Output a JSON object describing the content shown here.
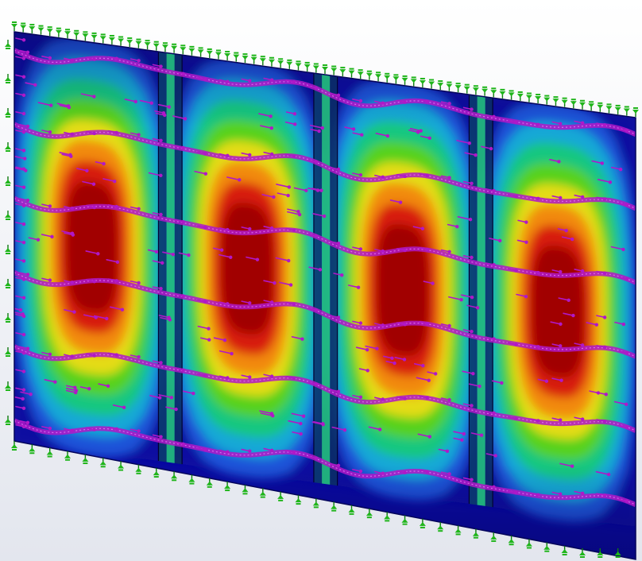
{
  "scene": {
    "background": {
      "top": "#ffffff",
      "bottom": "#e3e6ee"
    },
    "panel_count": 4,
    "stiffener_count": 3,
    "load_row_count": 6,
    "colormap": [
      "#0a0aa0",
      "#1d52d8",
      "#18a8d6",
      "#19c77f",
      "#56d21e",
      "#e4dc14",
      "#f28a10",
      "#d81c0c",
      "#a10404"
    ],
    "colors": {
      "load_arrow": "#b018c8",
      "fixture": "#1fb51a",
      "fixture_dark": "#0f7a10",
      "outline": "#04045a"
    },
    "icons": {
      "load": "force-arrow-icon",
      "fixture": "fixed-support-icon"
    }
  }
}
